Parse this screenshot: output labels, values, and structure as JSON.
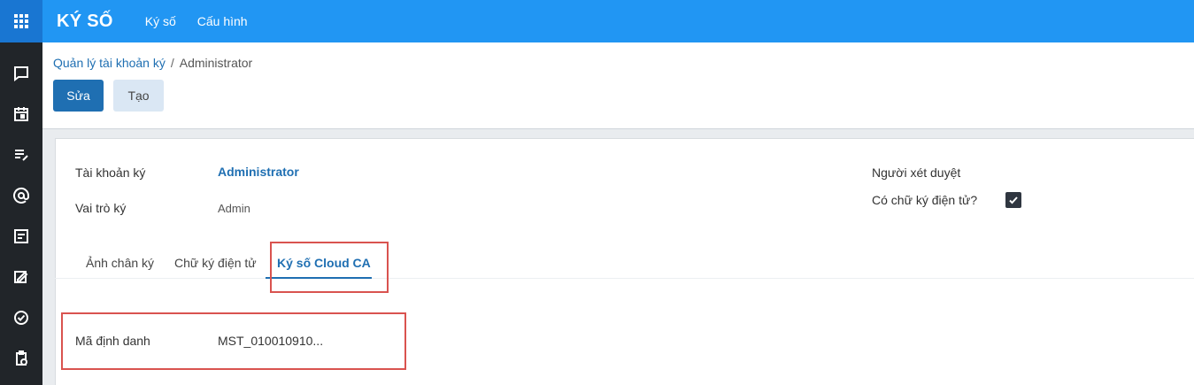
{
  "app": {
    "title": "KÝ SỐ",
    "menu": [
      "Ký số",
      "Cấu hình"
    ]
  },
  "sidebar": {
    "icons": [
      "chat-icon",
      "calendar-icon",
      "notes-icon",
      "at-icon",
      "document-icon",
      "sign-icon",
      "check-circle-icon",
      "clipboard-clock-icon"
    ]
  },
  "breadcrumb": {
    "parent": "Quản lý tài khoản ký",
    "separator": "/",
    "current": "Administrator"
  },
  "buttons": {
    "edit": "Sửa",
    "create": "Tạo"
  },
  "form": {
    "account_label": "Tài khoản ký",
    "account_value": "Administrator",
    "role_label": "Vai trò ký",
    "role_value": "Admin",
    "approver_label": "Người xét duyệt",
    "esign_label": "Có chữ ký điện tử?",
    "esign_checked": true
  },
  "tabs": {
    "items": [
      "Ảnh chân ký",
      "Chữ ký điện tử",
      "Ký số Cloud CA"
    ],
    "active_index": 2
  },
  "cloud_ca": {
    "id_label": "Mã định danh",
    "id_value": "MST_010010910..."
  },
  "colors": {
    "topbar": "#2196f3",
    "sidebar": "#212529",
    "primary": "#1f6fb2",
    "highlight": "#d9534f"
  }
}
